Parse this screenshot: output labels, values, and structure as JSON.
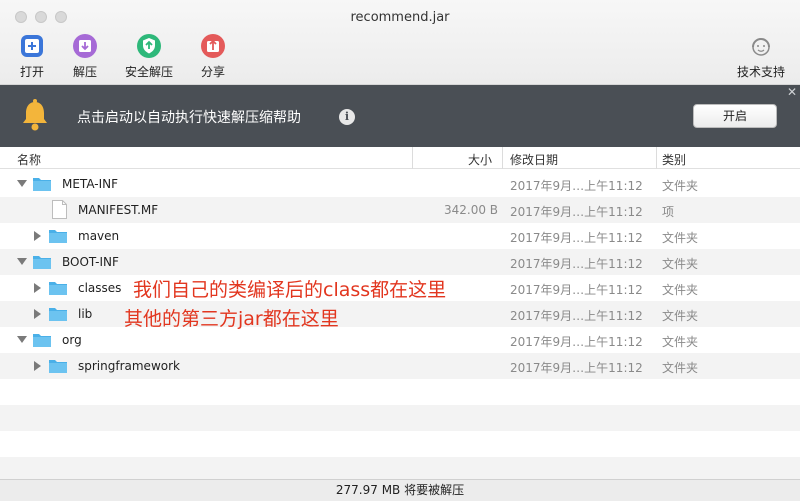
{
  "window": {
    "title": "recommend.jar"
  },
  "toolbar": {
    "open_label": "打开",
    "extract_label": "解压",
    "secure_extract_label": "安全解压",
    "share_label": "分享",
    "support_label": "技术支持"
  },
  "banner": {
    "text": "点击启动以自动执行快速解压缩帮助",
    "info_glyph": "i",
    "button_label": "开启",
    "close_glyph": "✕"
  },
  "columns": {
    "name": "名称",
    "size": "大小",
    "modified": "修改日期",
    "kind": "类别"
  },
  "rows": [
    {
      "name": "META-INF",
      "size": "",
      "date": "2017年9月…上午11:12",
      "kind": "文件夹"
    },
    {
      "name": "MANIFEST.MF",
      "size": "342.00 B",
      "date": "2017年9月…上午11:12",
      "kind": "项"
    },
    {
      "name": "maven",
      "size": "",
      "date": "2017年9月…上午11:12",
      "kind": "文件夹"
    },
    {
      "name": "BOOT-INF",
      "size": "",
      "date": "2017年9月…上午11:12",
      "kind": "文件夹"
    },
    {
      "name": "classes",
      "size": "",
      "date": "2017年9月…上午11:12",
      "kind": "文件夹"
    },
    {
      "name": "lib",
      "size": "",
      "date": "2017年9月…上午11:12",
      "kind": "文件夹"
    },
    {
      "name": "org",
      "size": "",
      "date": "2017年9月…上午11:12",
      "kind": "文件夹"
    },
    {
      "name": "springframework",
      "size": "",
      "date": "2017年9月…上午11:12",
      "kind": "文件夹"
    }
  ],
  "annotations": {
    "line1": "我们自己的类编译后的class都在这里",
    "line2": "其他的第三方jar都在这里"
  },
  "status": {
    "text": "277.97 MB 将要被解压"
  },
  "colors": {
    "banner_bg": "#4a4f55",
    "folder": "#4ab0e8",
    "annotation": "#e2361f"
  }
}
